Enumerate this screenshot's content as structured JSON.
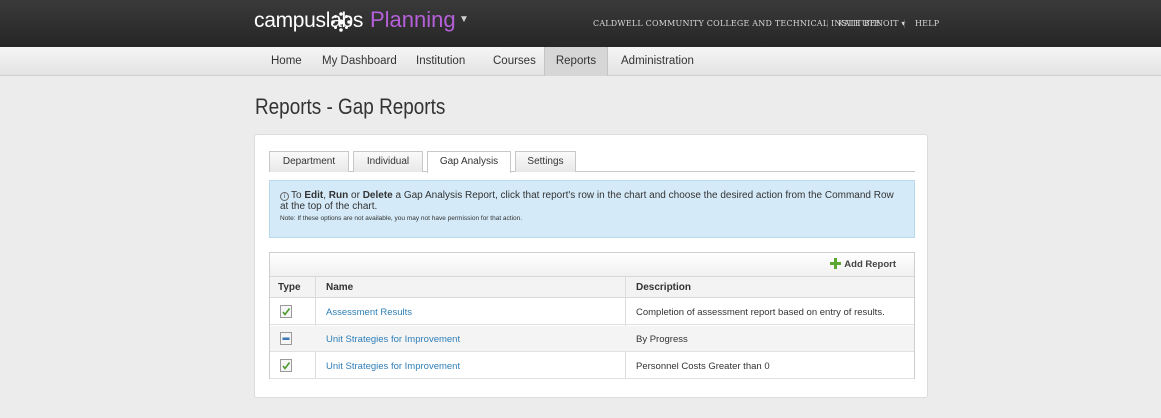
{
  "app": {
    "brand": "campuslabs",
    "product": "Planning",
    "institution": "CALDWELL COMMUNITY COLLEGE AND TECHNICAL INSTITUTE",
    "user": "KATE BENOIT",
    "help": "HELP",
    "colors": {
      "accent": "#b560d8",
      "link": "#2f7fb8",
      "info_bg": "#d4eaf8"
    }
  },
  "nav": {
    "items": [
      {
        "label": "Home"
      },
      {
        "label": "My Dashboard"
      },
      {
        "label": "Institution"
      },
      {
        "label": "Courses"
      },
      {
        "label": "Reports",
        "active": true
      },
      {
        "label": "Administration"
      }
    ]
  },
  "page": {
    "title": "Reports - Gap Reports"
  },
  "tabs": [
    {
      "label": "Department"
    },
    {
      "label": "Individual"
    },
    {
      "label": "Gap Analysis",
      "active": true
    },
    {
      "label": "Settings"
    }
  ],
  "info": {
    "line_pre": "To ",
    "edit": "Edit",
    "comma": ", ",
    "run": "Run",
    "or": " or ",
    "delete": "Delete",
    "line_post": " a Gap Analysis Report, click that report's row in the chart and choose the desired action from the Command Row at the top of the chart.",
    "note": "Note: If these options are not available, you may not have permission for that action."
  },
  "table": {
    "add_label": "Add Report",
    "headers": {
      "type": "Type",
      "name": "Name",
      "description": "Description"
    },
    "rows": [
      {
        "type_icon": "check-report-icon",
        "name": "Assessment Results",
        "description": "Completion of assessment report based on entry of results."
      },
      {
        "type_icon": "progress-report-icon",
        "name": "Unit Strategies for Improvement",
        "description": "By Progress"
      },
      {
        "type_icon": "check-report-icon",
        "name": "Unit Strategies for Improvement",
        "description": "Personnel Costs Greater than 0"
      }
    ]
  }
}
